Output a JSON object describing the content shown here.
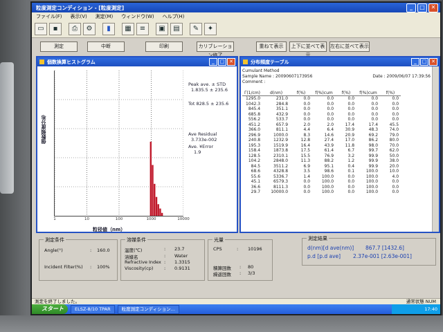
{
  "window": {
    "title": "粒度測定コンディション - [粒度測定]"
  },
  "menu": [
    "ファイル(F)",
    "表示(V)",
    "測定(M)",
    "ウィンドウ(W)",
    "ヘルプ(H)"
  ],
  "toolbar_icons": [
    "new-file-icon",
    "save-icon",
    "print-icon",
    "settings-icon",
    "graph-icon",
    "table-icon",
    "list-icon",
    "calendar-icon",
    "report-icon",
    "tool-icon"
  ],
  "command_buttons": [
    {
      "name": "measure-button",
      "label": "測定"
    },
    {
      "name": "stop-button",
      "label": "中断"
    },
    {
      "name": "print-button",
      "label": "印刷"
    },
    {
      "name": "calibration-end-button",
      "label": "カリブレーション終了"
    },
    {
      "name": "overlay-button",
      "label": "重ねて表示"
    },
    {
      "name": "tile-vertical-button",
      "label": "上下に並べて表示"
    },
    {
      "name": "tile-horizontal-button",
      "label": "左右に並べて表示"
    }
  ],
  "histogram": {
    "title": "個数換算ヒストグラム",
    "ylabel": "個数頻度分布",
    "xlabel": "粒径値（nm）",
    "stats": {
      "peak_label": "Peak ave. ± STD",
      "peak_value": "1.835.5 ± 235.6",
      "tot_label": "Tot 828.5 ± 235.6",
      "residual_label": "Ave Residual",
      "residual_value": "3.733e-002",
      "iteration_label": "Ave. ¥Error",
      "iteration_value": "1.9"
    }
  },
  "chart_data": {
    "type": "bar",
    "x_axis": "particle diameter (nm), log scale",
    "x_ticks": [
      "1",
      "10",
      "100",
      "1000",
      "10000"
    ],
    "xlim": [
      1,
      10000
    ],
    "ylim": [
      0,
      100
    ],
    "bars": [
      {
        "x": 966.3,
        "y": 51
      },
      {
        "x": 1104.2,
        "y": 35
      },
      {
        "x": 1265.8,
        "y": 22
      },
      {
        "x": 1450.9,
        "y": 13
      },
      {
        "x": 1658.4,
        "y": 8
      },
      {
        "x": 1898.5,
        "y": 5
      },
      {
        "x": 2170.0,
        "y": 2
      }
    ]
  },
  "dist_table": {
    "title": "分布頻度テーブル",
    "method_label": "Cumulant Method",
    "sample_label": "Sample Name : 20090607173956",
    "comment_label": "Comment :",
    "date_label": "Date : 2009/06/07 17:39:56",
    "headers": [
      "Γ(1/cm)",
      "d(nm)",
      "f(%)",
      "f(%)cum",
      "f(%)",
      "f(%)cum",
      "f(%)"
    ],
    "rows": [
      [
        "1295.0",
        "231.0",
        "0.0",
        "0.0",
        "0.0",
        "0.0",
        "0.0"
      ],
      [
        "1042.3",
        "284.8",
        "0.0",
        "0.0",
        "0.0",
        "0.0",
        "0.0"
      ],
      [
        "845.4",
        "351.1",
        "0.0",
        "0.0",
        "0.0",
        "0.0",
        "0.0"
      ],
      [
        "685.8",
        "432.9",
        "0.0",
        "0.0",
        "0.0",
        "0.0",
        "0.0"
      ],
      [
        "556.2",
        "533.7",
        "0.0",
        "0.0",
        "0.0",
        "0.0",
        "0.0"
      ],
      [
        "451.2",
        "657.9",
        "2.0",
        "2.0",
        "17.4",
        "17.4",
        "45.5"
      ],
      [
        "366.0",
        "811.1",
        "4.4",
        "6.4",
        "30.9",
        "48.3",
        "74.0"
      ],
      [
        "296.9",
        "1000.0",
        "8.3",
        "14.6",
        "20.9",
        "69.2",
        "79.0"
      ],
      [
        "240.8",
        "1232.9",
        "12.8",
        "27.4",
        "17.0",
        "86.2",
        "80.0"
      ],
      [
        "195.3",
        "1519.9",
        "16.4",
        "43.9",
        "11.8",
        "98.0",
        "70.0"
      ],
      [
        "158.4",
        "1873.8",
        "17.5",
        "61.4",
        "6.7",
        "99.7",
        "62.0"
      ],
      [
        "128.5",
        "2310.1",
        "15.5",
        "76.9",
        "3.2",
        "99.9",
        "50.0"
      ],
      [
        "104.2",
        "2848.0",
        "11.3",
        "88.2",
        "1.2",
        "99.9",
        "38.0"
      ],
      [
        "84.5",
        "3511.2",
        "6.9",
        "95.1",
        "0.4",
        "99.9",
        "20.0"
      ],
      [
        "68.6",
        "4328.8",
        "3.5",
        "98.6",
        "0.1",
        "100.0",
        "10.0"
      ],
      [
        "55.6",
        "5336.7",
        "1.4",
        "100.0",
        "0.0",
        "100.0",
        "4.0"
      ],
      [
        "45.1",
        "6579.3",
        "0.0",
        "100.0",
        "0.0",
        "100.0",
        "0.0"
      ],
      [
        "36.6",
        "8111.3",
        "0.0",
        "100.0",
        "0.0",
        "100.0",
        "0.0"
      ],
      [
        "29.7",
        "10000.0",
        "0.0",
        "100.0",
        "0.0",
        "100.0",
        "0.0"
      ]
    ]
  },
  "conditions": {
    "title": "測定条件",
    "angle_label": "Angle(°)",
    "angle_value": "160.0",
    "filter_label": "Incident Filter(%)",
    "filter_value": "100%"
  },
  "solvent": {
    "title": "溶媒条件",
    "temp_label": "温度(℃)",
    "temp_value": "23.7",
    "name_label": "溶媒名",
    "name_value": "Water",
    "ri_label": "Refractive Index",
    "ri_value": "1.3315",
    "visc_label": "Viscosity(cp)",
    "visc_value": "0.9131"
  },
  "light": {
    "title": "光量",
    "cps_label": "CPS",
    "cps_value": "10196",
    "accum_label": "積算回数",
    "accum_value": "80",
    "repeat_label": "繰返回数",
    "repeat_value": "3/3"
  },
  "results": {
    "title": "測定結果",
    "d_label": "d(nm)[d ave(nm)]",
    "d_value": "867.7 [1432.6]",
    "pd_label": "p.d [p.d ave]",
    "pd_value": "2.37e-001 [2.63e-001]"
  },
  "status": {
    "left": "測定を終了しました。",
    "right": "通常状態    NUM"
  },
  "taskbar": {
    "start": "スタート",
    "items": [
      "ELSZ-8/10 TPAR",
      "粒度測定コンディション..."
    ],
    "clock": "17:40"
  },
  "colors": {
    "bar": "#c0182a",
    "title_blue": "#1d4fc0",
    "result_blue": "#1a3fb0"
  }
}
